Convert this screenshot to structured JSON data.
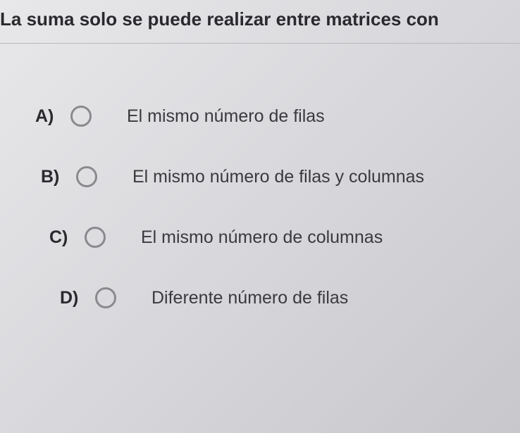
{
  "question": {
    "text": "La suma solo se puede realizar entre matrices con"
  },
  "options": [
    {
      "letter": "A)",
      "text": "El mismo número de filas"
    },
    {
      "letter": "B)",
      "text": "El mismo número de filas y columnas"
    },
    {
      "letter": "C)",
      "text": "El mismo número de columnas"
    },
    {
      "letter": "D)",
      "text": "Diferente número de filas"
    }
  ]
}
